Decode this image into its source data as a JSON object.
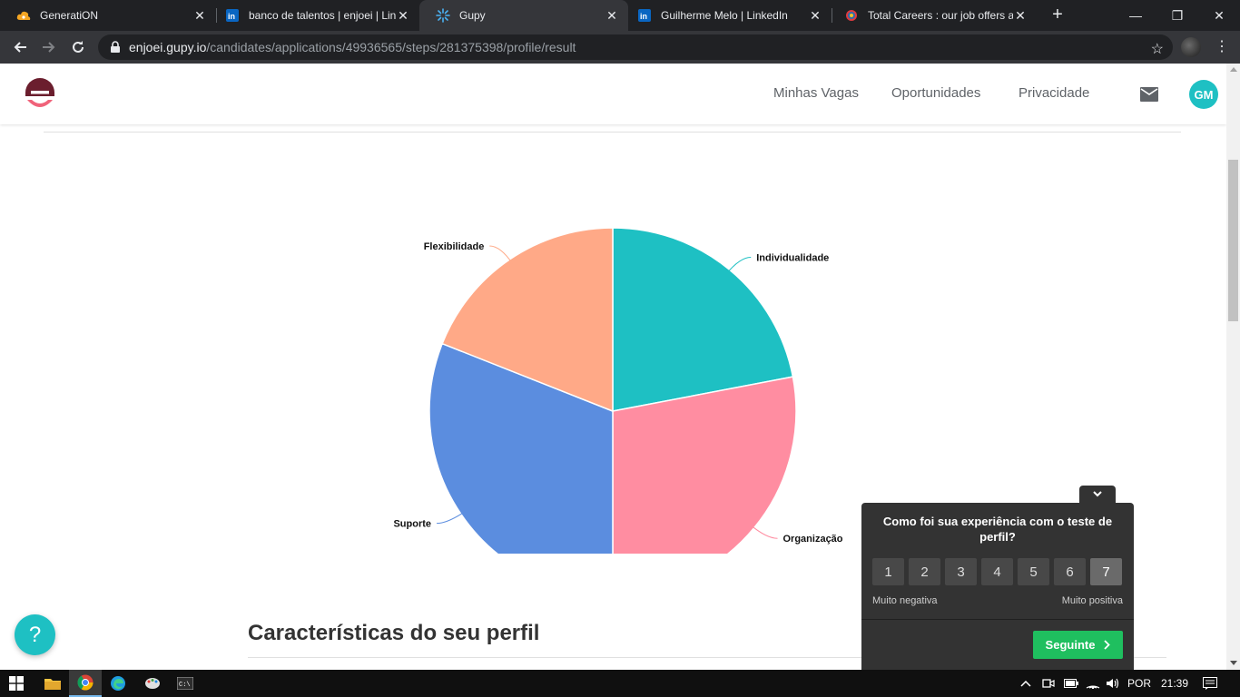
{
  "browser": {
    "tabs": [
      {
        "title": "GeneratiON",
        "icon": "cloud-icon",
        "active": false
      },
      {
        "title": "banco de talentos | enjoei | Lin",
        "icon": "linkedin-icon",
        "active": false
      },
      {
        "title": "Gupy",
        "icon": "gupy-icon",
        "active": true
      },
      {
        "title": "Guilherme Melo | LinkedIn",
        "icon": "linkedin-icon",
        "active": false
      },
      {
        "title": "Total Careers : our job offers an",
        "icon": "total-icon",
        "active": false
      }
    ],
    "url_host": "enjoei.gupy.io",
    "url_path": "/candidates/applications/49936565/steps/281375398/profile/result"
  },
  "header": {
    "nav": [
      "Minhas Vagas",
      "Oportunidades",
      "Privacidade"
    ],
    "avatar_initials": "GM"
  },
  "chart_data": {
    "type": "pie",
    "categories": [
      "Individualidade",
      "Organização",
      "Suporte",
      "Flexibilidade"
    ],
    "values": [
      22,
      28,
      31,
      19
    ],
    "colors": [
      "#1ec0c3",
      "#ff8da1",
      "#5b8ddf",
      "#ffa987"
    ]
  },
  "section": {
    "title": "Características do seu perfil"
  },
  "help": {
    "label": "?"
  },
  "feedback": {
    "question": "Como foi sua experiência com o teste de perfil?",
    "scale": [
      "1",
      "2",
      "3",
      "4",
      "5",
      "6",
      "7"
    ],
    "selected": "7",
    "low_label": "Muito negativa",
    "high_label": "Muito positiva",
    "next_label": "Seguinte"
  },
  "taskbar": {
    "language": "POR",
    "time": "21:39"
  }
}
